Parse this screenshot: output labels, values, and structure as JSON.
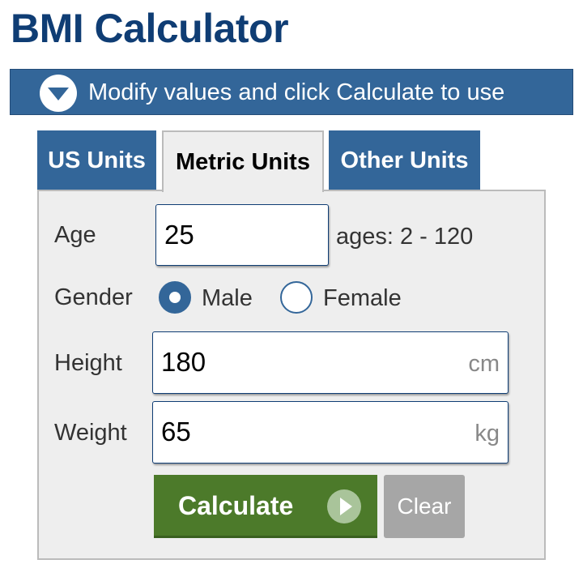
{
  "page": {
    "title": "BMI Calculator"
  },
  "banner": {
    "text": "Modify values and click Calculate to use",
    "icon": "chevron-down-circle-icon"
  },
  "tabs": [
    {
      "label": "US Units",
      "active": false
    },
    {
      "label": "Metric Units",
      "active": true
    },
    {
      "label": "Other Units",
      "active": false
    }
  ],
  "form": {
    "age": {
      "label": "Age",
      "value": "25",
      "hint": "ages: 2 - 120"
    },
    "gender": {
      "label": "Gender",
      "options": [
        {
          "label": "Male",
          "checked": true
        },
        {
          "label": "Female",
          "checked": false
        }
      ]
    },
    "height": {
      "label": "Height",
      "value": "180",
      "unit": "cm"
    },
    "weight": {
      "label": "Weight",
      "value": "65",
      "unit": "kg"
    }
  },
  "buttons": {
    "calculate": "Calculate",
    "calculate_icon": "play-circle-icon",
    "clear": "Clear"
  },
  "colors": {
    "title": "#0f3d74",
    "accent": "#336699",
    "calculate_bg": "#4c7a2a",
    "clear_bg": "#a6a6a6",
    "panel_bg": "#eeeeee"
  }
}
